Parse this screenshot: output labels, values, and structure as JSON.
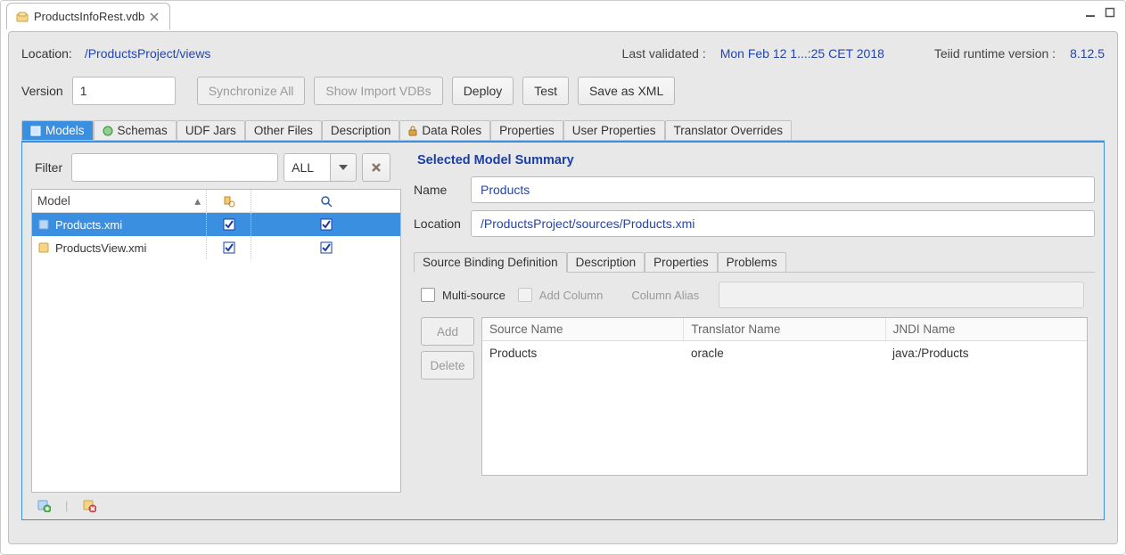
{
  "file_tab": {
    "name": "ProductsInfoRest.vdb"
  },
  "header": {
    "location_label": "Location:",
    "location_value": "/ProductsProject/views",
    "last_validated_label": "Last validated :",
    "last_validated_value": "Mon Feb 12 1...:25 CET 2018",
    "runtime_label": "Teiid runtime version :",
    "runtime_value": "8.12.5"
  },
  "toolbar": {
    "version_label": "Version",
    "version_value": "1",
    "sync_all": "Synchronize All",
    "show_import_vdbs": "Show Import VDBs",
    "deploy": "Deploy",
    "test": "Test",
    "save_xml": "Save as XML"
  },
  "tabs": {
    "models": "Models",
    "schemas": "Schemas",
    "udf_jars": "UDF Jars",
    "other_files": "Other Files",
    "description": "Description",
    "data_roles": "Data Roles",
    "properties": "Properties",
    "user_properties": "User Properties",
    "translator_overrides": "Translator Overrides"
  },
  "filter": {
    "label": "Filter",
    "value": "",
    "scope": "ALL"
  },
  "model_table": {
    "header": "Model",
    "rows": [
      {
        "name": "Products.xmi",
        "c1": true,
        "c2": true,
        "selected": true,
        "kind": "source"
      },
      {
        "name": "ProductsView.xmi",
        "c1": true,
        "c2": true,
        "selected": false,
        "kind": "view"
      }
    ]
  },
  "summary": {
    "title": "Selected Model Summary",
    "name_label": "Name",
    "name_value": "Products",
    "location_label": "Location",
    "location_value": "/ProductsProject/sources/Products.xmi"
  },
  "sub_tabs": {
    "source_binding": "Source Binding Definition",
    "description": "Description",
    "properties": "Properties",
    "problems": "Problems"
  },
  "binding": {
    "multi_source_label": "Multi-source",
    "add_column_label": "Add Column",
    "column_alias_label": "Column Alias",
    "add_btn": "Add",
    "delete_btn": "Delete",
    "columns": {
      "source": "Source Name",
      "translator": "Translator Name",
      "jndi": "JNDI Name"
    },
    "rows": [
      {
        "source": "Products",
        "translator": "oracle",
        "jndi": "java:/Products"
      }
    ]
  }
}
